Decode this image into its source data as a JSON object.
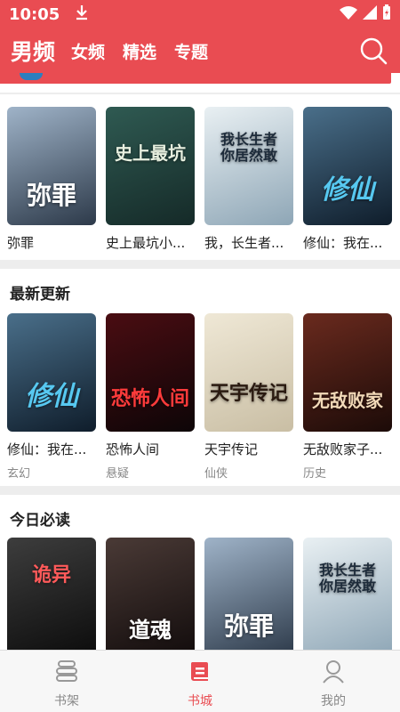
{
  "status": {
    "time": "10:05"
  },
  "header": {
    "tabs": [
      {
        "label": "男频",
        "active": true
      },
      {
        "label": "女频",
        "active": false
      },
      {
        "label": "精选",
        "active": false
      },
      {
        "label": "专题",
        "active": false
      }
    ]
  },
  "sections": [
    {
      "title": "",
      "books": [
        {
          "name": "弥罪",
          "cover_text": "弥罪",
          "colors": [
            "#9fb3c8",
            "#2d3a4a"
          ],
          "text_color": "#ffffff"
        },
        {
          "name": "史上最坑小...",
          "cover_text": "史上最坑",
          "colors": [
            "#2f5a52",
            "#152a28"
          ],
          "text_color": "#e8f0e0"
        },
        {
          "name": "我，长生者...",
          "cover_text": "我长生者你居然敢",
          "colors": [
            "#e9f0f3",
            "#8ea6b6"
          ],
          "text_color": "#1d2b3a"
        },
        {
          "name": "修仙：我在...",
          "cover_text": "修仙",
          "colors": [
            "#4a6f8a",
            "#0f1d2b"
          ],
          "text_color": "#57c8f0"
        }
      ]
    },
    {
      "title": "最新更新",
      "books": [
        {
          "name": "修仙：我在...",
          "category": "玄幻",
          "cover_text": "修仙",
          "colors": [
            "#4a6f8a",
            "#0f1d2b"
          ],
          "text_color": "#57c8f0"
        },
        {
          "name": "恐怖人间",
          "category": "悬疑",
          "cover_text": "恐怖人间",
          "colors": [
            "#4a0d12",
            "#0d0507"
          ],
          "text_color": "#ff3b3b"
        },
        {
          "name": "天宇传记",
          "category": "仙侠",
          "cover_text": "天宇传记",
          "colors": [
            "#efe8d6",
            "#c9bea4"
          ],
          "text_color": "#2a1a10"
        },
        {
          "name": "无敌败家子...",
          "category": "历史",
          "cover_text": "无敌败家",
          "colors": [
            "#6a2a1e",
            "#1c0b08"
          ],
          "text_color": "#f2d9b8"
        }
      ]
    },
    {
      "title": "今日必读",
      "books": [
        {
          "name": "",
          "cover_text": "诡异",
          "colors": [
            "#3d3d3d",
            "#0c0c0c"
          ],
          "text_color": "#ff5a5a"
        },
        {
          "name": "",
          "cover_text": "道魂",
          "colors": [
            "#4a3a36",
            "#120c0c"
          ],
          "text_color": "#ffffff"
        },
        {
          "name": "",
          "cover_text": "弥罪",
          "colors": [
            "#9fb3c8",
            "#2d3a4a"
          ],
          "text_color": "#ffffff"
        },
        {
          "name": "",
          "cover_text": "我长生者你居然敢",
          "colors": [
            "#e9f0f3",
            "#8ea6b6"
          ],
          "text_color": "#1d2b3a"
        }
      ]
    }
  ],
  "bottom_nav": [
    {
      "label": "书架",
      "icon": "bookshelf-icon",
      "active": false
    },
    {
      "label": "书城",
      "icon": "bookstore-icon",
      "active": true
    },
    {
      "label": "我的",
      "icon": "profile-icon",
      "active": false
    }
  ],
  "accent": "#e94c52"
}
